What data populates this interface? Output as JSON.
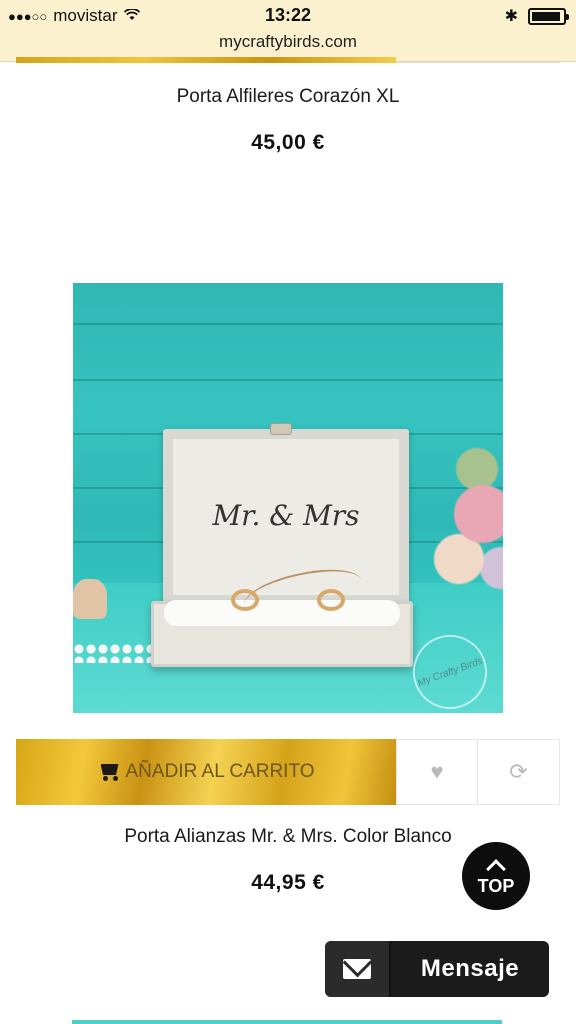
{
  "status_bar": {
    "signal": "●●●○○",
    "carrier": "movistar",
    "time": "13:22",
    "bluetooth": "✱",
    "url": "mycraftybirds.com"
  },
  "products": [
    {
      "title": "Porta Alfileres Corazón XL",
      "price": "45,00 €"
    },
    {
      "title": "Porta Alianzas Mr. & Mrs. Color Blanco",
      "price": "44,95 €",
      "image_text": "Mr. & Mrs",
      "stamp_text": "My Crafty Birds"
    }
  ],
  "actions": {
    "add_to_cart": "AÑADIR AL CARRITO",
    "favorite_icon": "heart-icon",
    "compare_icon": "refresh-icon"
  },
  "top_button": {
    "label": "TOP"
  },
  "message_button": {
    "label": "Mensaje"
  },
  "colors": {
    "url_bar": "#fbf1cf",
    "gold": "#f0c53a",
    "teal": "#37c3bf",
    "dark": "#1b1b1b"
  }
}
